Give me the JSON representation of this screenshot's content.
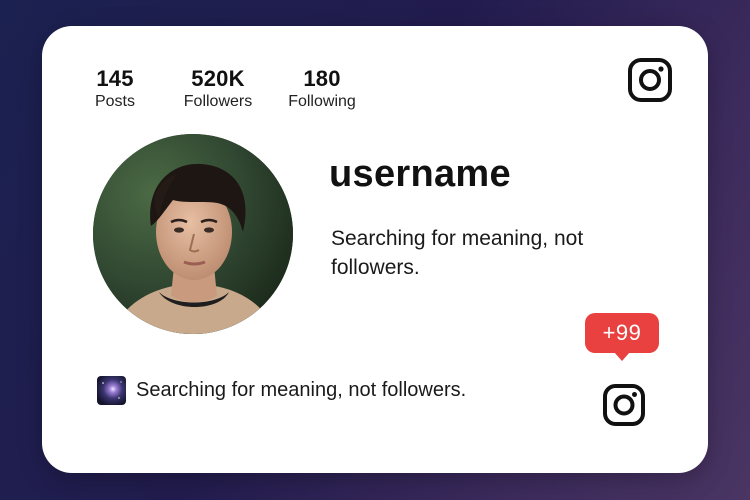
{
  "stats": {
    "posts": {
      "value": "145",
      "label": "Posts"
    },
    "followers": {
      "value": "520K",
      "label": "Followers"
    },
    "following": {
      "value": "180",
      "label": "Following"
    }
  },
  "profile": {
    "username": "username",
    "bio": "Searching for meaning, not followers.",
    "status_text": "Searching for meaning, not followers."
  },
  "notification": {
    "badge": "+99",
    "color": "#e8413f"
  },
  "icons": {
    "top": "instagram-icon",
    "bottom": "instagram-icon",
    "status": "galaxy-thumbnail-icon"
  },
  "colors": {
    "background_start": "#1b2150",
    "background_end": "#4a3563",
    "card": "#ffffff",
    "text": "#111111"
  }
}
